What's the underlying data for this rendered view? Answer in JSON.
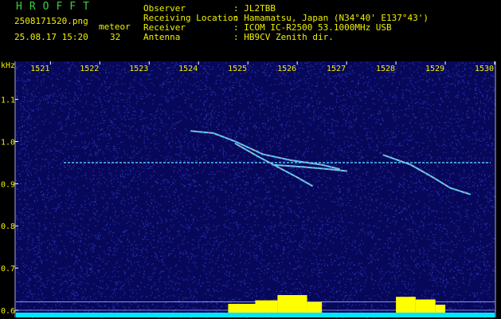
{
  "header": {
    "app_title": "HROFFT",
    "filename": "2508171520.png",
    "datetime": "25.08.17 15:20",
    "count_label": "meteor",
    "count_value": "32",
    "fields": [
      {
        "label": "Observer",
        "value": ": JL2TBB"
      },
      {
        "label": "Receiving Location",
        "value": ": Hamamatsu, Japan (N34°40' E137°43')"
      },
      {
        "label": "Receiver",
        "value": ": ICOM IC-R2500 53.1000MHz USB"
      },
      {
        "label": "Antenna",
        "value": ": HB9CV Zenith dir."
      }
    ]
  },
  "colors": {
    "background": "#000000",
    "spectrogram_bg": "#08085a",
    "noise": "#2d3cc8",
    "carrier": "#5ad2ff",
    "echo_hot": "#e06a6a",
    "text_yellow": "#f0f000",
    "text_green": "#3ccf3c",
    "baseline": "#00e6ff",
    "activity": "#ffff00"
  },
  "chart_data": {
    "type": "heatmap",
    "ylabel": "kHz",
    "x_ticks": [
      "1521",
      "1522",
      "1523",
      "1524",
      "1525",
      "1526",
      "1527",
      "1528",
      "1529",
      "1530"
    ],
    "y_ticks": [
      "1.1",
      "1.0",
      "0.9",
      "0.8",
      "0.7",
      "0.6"
    ],
    "xlim": [
      1520.3,
      1530.0
    ],
    "ylim": [
      0.583,
      1.19
    ],
    "carrier_khz": 0.95,
    "echo_traces": [
      {
        "points": [
          [
            1523.85,
            1.025
          ],
          [
            1524.3,
            1.02
          ],
          [
            1524.75,
            1.0
          ],
          [
            1525.3,
            0.97
          ],
          [
            1525.9,
            0.955
          ],
          [
            1526.5,
            0.945
          ],
          [
            1526.85,
            0.935
          ]
        ]
      },
      {
        "points": [
          [
            1524.75,
            0.995
          ],
          [
            1525.2,
            0.965
          ],
          [
            1525.6,
            0.94
          ],
          [
            1526.0,
            0.915
          ],
          [
            1526.3,
            0.895
          ]
        ]
      },
      {
        "points": [
          [
            1525.5,
            0.945
          ],
          [
            1526.1,
            0.94
          ],
          [
            1526.6,
            0.935
          ],
          [
            1527.0,
            0.93
          ]
        ]
      },
      {
        "points": [
          [
            1527.75,
            0.968
          ],
          [
            1528.3,
            0.945
          ],
          [
            1528.75,
            0.915
          ],
          [
            1529.1,
            0.89
          ],
          [
            1529.5,
            0.875
          ]
        ]
      }
    ],
    "activity_bursts": [
      {
        "start": 1524.6,
        "end": 1525.15,
        "level": 0.5
      },
      {
        "start": 1525.15,
        "end": 1525.6,
        "level": 0.7
      },
      {
        "start": 1525.6,
        "end": 1526.2,
        "level": 1.0
      },
      {
        "start": 1526.2,
        "end": 1526.5,
        "level": 0.6
      },
      {
        "start": 1528.0,
        "end": 1528.4,
        "level": 0.9
      },
      {
        "start": 1528.4,
        "end": 1528.8,
        "level": 0.75
      },
      {
        "start": 1528.8,
        "end": 1529.0,
        "level": 0.45
      }
    ]
  }
}
